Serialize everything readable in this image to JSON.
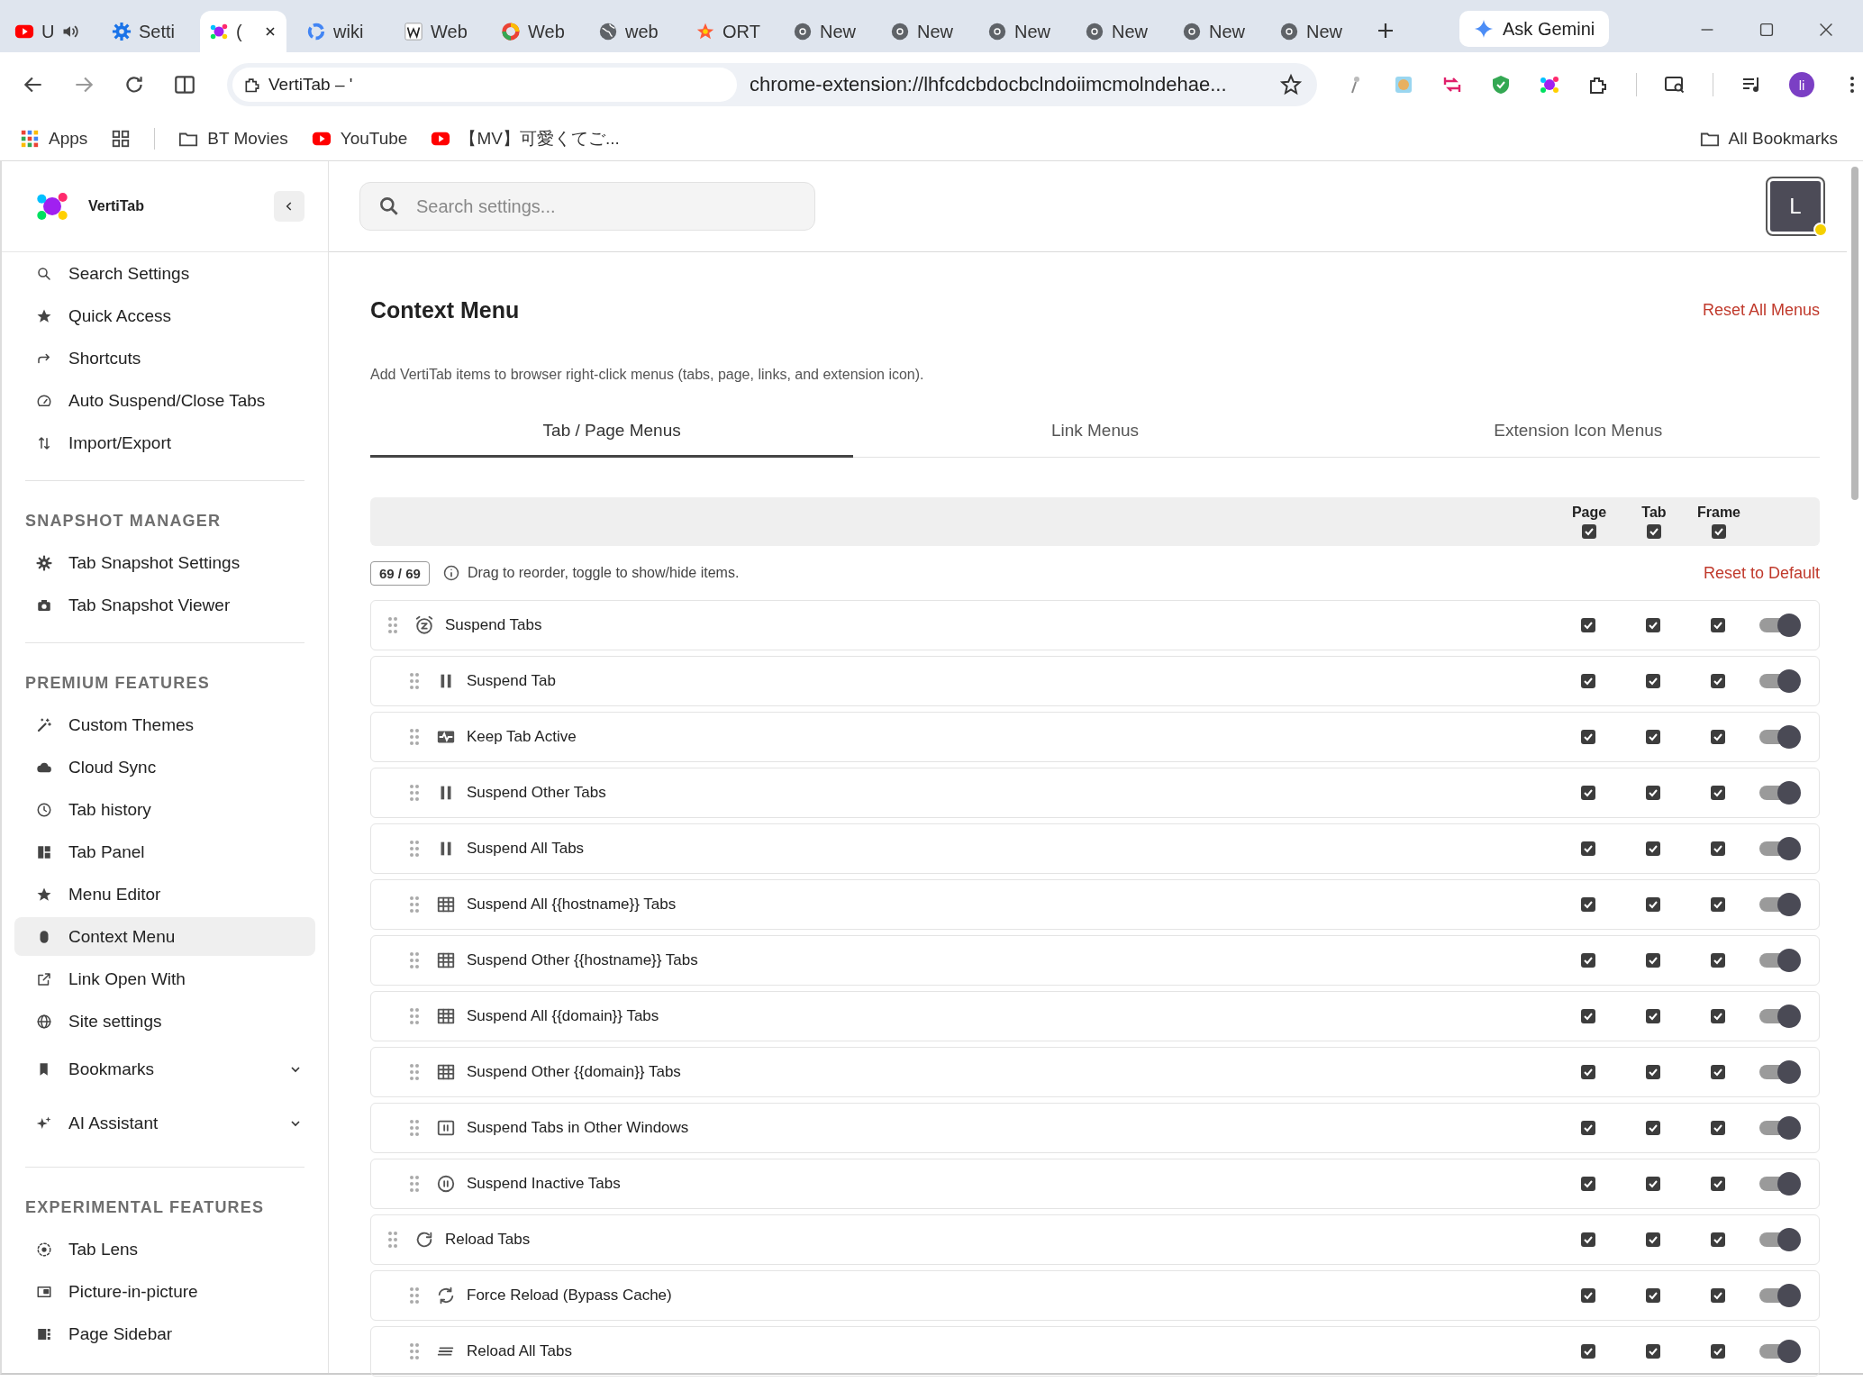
{
  "browser": {
    "tabs": [
      {
        "kind": "video",
        "label": "U",
        "selected": false,
        "audible": true
      },
      {
        "kind": "settings",
        "label": "Setti",
        "selected": false,
        "audible": false
      },
      {
        "kind": "splash",
        "label": "(",
        "selected": true,
        "audible": false
      },
      {
        "kind": "search",
        "label": "wiki",
        "selected": false,
        "audible": false
      },
      {
        "kind": "wiki",
        "label": "Web",
        "selected": false,
        "audible": false
      },
      {
        "kind": "ring",
        "label": "Web",
        "selected": false,
        "audible": false
      },
      {
        "kind": "globe",
        "label": "web",
        "selected": false,
        "audible": false
      },
      {
        "kind": "star",
        "label": "ORT",
        "selected": false,
        "audible": false
      },
      {
        "kind": "newtab",
        "label": "New",
        "selected": false,
        "audible": false
      },
      {
        "kind": "newtab",
        "label": "New",
        "selected": false,
        "audible": false
      },
      {
        "kind": "newtab",
        "label": "New",
        "selected": false,
        "audible": false
      },
      {
        "kind": "newtab",
        "label": "New",
        "selected": false,
        "audible": false
      },
      {
        "kind": "newtab",
        "label": "New",
        "selected": false,
        "audible": false
      },
      {
        "kind": "newtab",
        "label": "New",
        "selected": false,
        "audible": false
      }
    ],
    "gemini": "Ask Gemini",
    "address": {
      "title": "VertiTab – '",
      "url": "chrome-extension://lhfcdcbdocbclndoiimcmolndehae..."
    },
    "profile": "li",
    "bookmarks_bar": {
      "apps": "Apps",
      "items": [
        {
          "kind": "folder",
          "label": "BT Movies"
        },
        {
          "kind": "video",
          "label": "YouTube"
        },
        {
          "kind": "video",
          "label": "【MV】可愛くてご..."
        }
      ],
      "all": "All Bookmarks"
    }
  },
  "sidebar": {
    "app_name": "VertiTab",
    "sections": [
      {
        "items": [
          {
            "kind": "search",
            "label": "Search Settings",
            "selected": false
          },
          {
            "kind": "star",
            "label": "Quick Access",
            "selected": false
          },
          {
            "kind": "share",
            "label": "Shortcuts",
            "selected": false
          },
          {
            "kind": "gauge",
            "label": "Auto Suspend/Close Tabs",
            "selected": false
          },
          {
            "kind": "updown",
            "label": "Import/Export",
            "selected": false
          }
        ]
      },
      {
        "title": "SNAPSHOT MANAGER",
        "items": [
          {
            "kind": "gear",
            "label": "Tab Snapshot Settings",
            "selected": false
          },
          {
            "kind": "camera",
            "label": "Tab Snapshot Viewer",
            "selected": false
          }
        ]
      },
      {
        "title": "PREMIUM FEATURES",
        "items": [
          {
            "kind": "wand",
            "label": "Custom Themes",
            "selected": false
          },
          {
            "kind": "cloud",
            "label": "Cloud Sync",
            "selected": false
          },
          {
            "kind": "clock",
            "label": "Tab history",
            "selected": false
          },
          {
            "kind": "panel",
            "label": "Tab Panel",
            "selected": false
          },
          {
            "kind": "star",
            "label": "Menu Editor",
            "selected": false
          },
          {
            "kind": "mouse",
            "label": "Context Menu",
            "selected": true
          },
          {
            "kind": "external",
            "label": "Link Open With",
            "selected": false
          },
          {
            "kind": "globe",
            "label": "Site settings",
            "selected": false
          },
          {
            "kind": "bookmark",
            "label": "Bookmarks",
            "selected": false,
            "expanded": false
          },
          {
            "kind": "sparkle",
            "label": "AI Assistant",
            "selected": false,
            "expanded": false
          }
        ]
      },
      {
        "title": "EXPERIMENTAL FEATURES",
        "items": [
          {
            "kind": "lens",
            "label": "Tab Lens",
            "selected": false
          },
          {
            "kind": "pip",
            "label": "Picture-in-picture",
            "selected": false
          },
          {
            "kind": "sidebar",
            "label": "Page Sidebar",
            "selected": false
          }
        ]
      }
    ]
  },
  "main": {
    "search": {
      "placeholder": "Search settings..."
    },
    "avatar": "L",
    "title": "Context Menu",
    "reset_all": "Reset All Menus",
    "description": "Add VertiTab items to browser right-click menus (tabs, page, links, and extension icon).",
    "tabs": [
      {
        "label": "Tab / Page Menus",
        "selected": true
      },
      {
        "label": "Link Menus",
        "selected": false
      },
      {
        "label": "Extension Icon Menus",
        "selected": false
      }
    ],
    "columns": [
      {
        "label": "Page",
        "checked": true
      },
      {
        "label": "Tab",
        "checked": true
      },
      {
        "label": "Frame",
        "checked": true
      }
    ],
    "count": "69 / 69",
    "hint": "Drag to reorder, toggle to show/hide items.",
    "reset_default": "Reset to Default",
    "rows": [
      {
        "kind": "snooze",
        "label": "Suspend Tabs",
        "page": true,
        "tab": true,
        "frame": true,
        "enabled": true,
        "children": [
          {
            "kind": "pause",
            "label": "Suspend Tab",
            "page": true,
            "tab": true,
            "frame": true,
            "enabled": true
          },
          {
            "kind": "pulse",
            "label": "Keep Tab Active",
            "page": true,
            "tab": true,
            "frame": true,
            "enabled": true
          },
          {
            "kind": "pause",
            "label": "Suspend Other Tabs",
            "page": true,
            "tab": true,
            "frame": true,
            "enabled": true
          },
          {
            "kind": "pause",
            "label": "Suspend All Tabs",
            "page": true,
            "tab": true,
            "frame": true,
            "enabled": true
          },
          {
            "kind": "grid",
            "label": "Suspend All {{hostname}} Tabs",
            "page": true,
            "tab": true,
            "frame": true,
            "enabled": true
          },
          {
            "kind": "grid",
            "label": "Suspend Other {{hostname}} Tabs",
            "page": true,
            "tab": true,
            "frame": true,
            "enabled": true
          },
          {
            "kind": "grid",
            "label": "Suspend All {{domain}} Tabs",
            "page": true,
            "tab": true,
            "frame": true,
            "enabled": true
          },
          {
            "kind": "grid",
            "label": "Suspend Other {{domain}} Tabs",
            "page": true,
            "tab": true,
            "frame": true,
            "enabled": true
          },
          {
            "kind": "windowpause",
            "label": "Suspend Tabs in Other Windows",
            "page": true,
            "tab": true,
            "frame": true,
            "enabled": true
          },
          {
            "kind": "circlepause",
            "label": "Suspend Inactive Tabs",
            "page": true,
            "tab": true,
            "frame": true,
            "enabled": true
          }
        ]
      },
      {
        "kind": "reload",
        "label": "Reload Tabs",
        "page": true,
        "tab": true,
        "frame": true,
        "enabled": true,
        "children": [
          {
            "kind": "sync",
            "label": "Force Reload (Bypass Cache)",
            "page": true,
            "tab": true,
            "frame": true,
            "enabled": true
          },
          {
            "kind": "lines",
            "label": "Reload All Tabs",
            "page": true,
            "tab": true,
            "frame": true,
            "enabled": true
          }
        ]
      }
    ]
  }
}
